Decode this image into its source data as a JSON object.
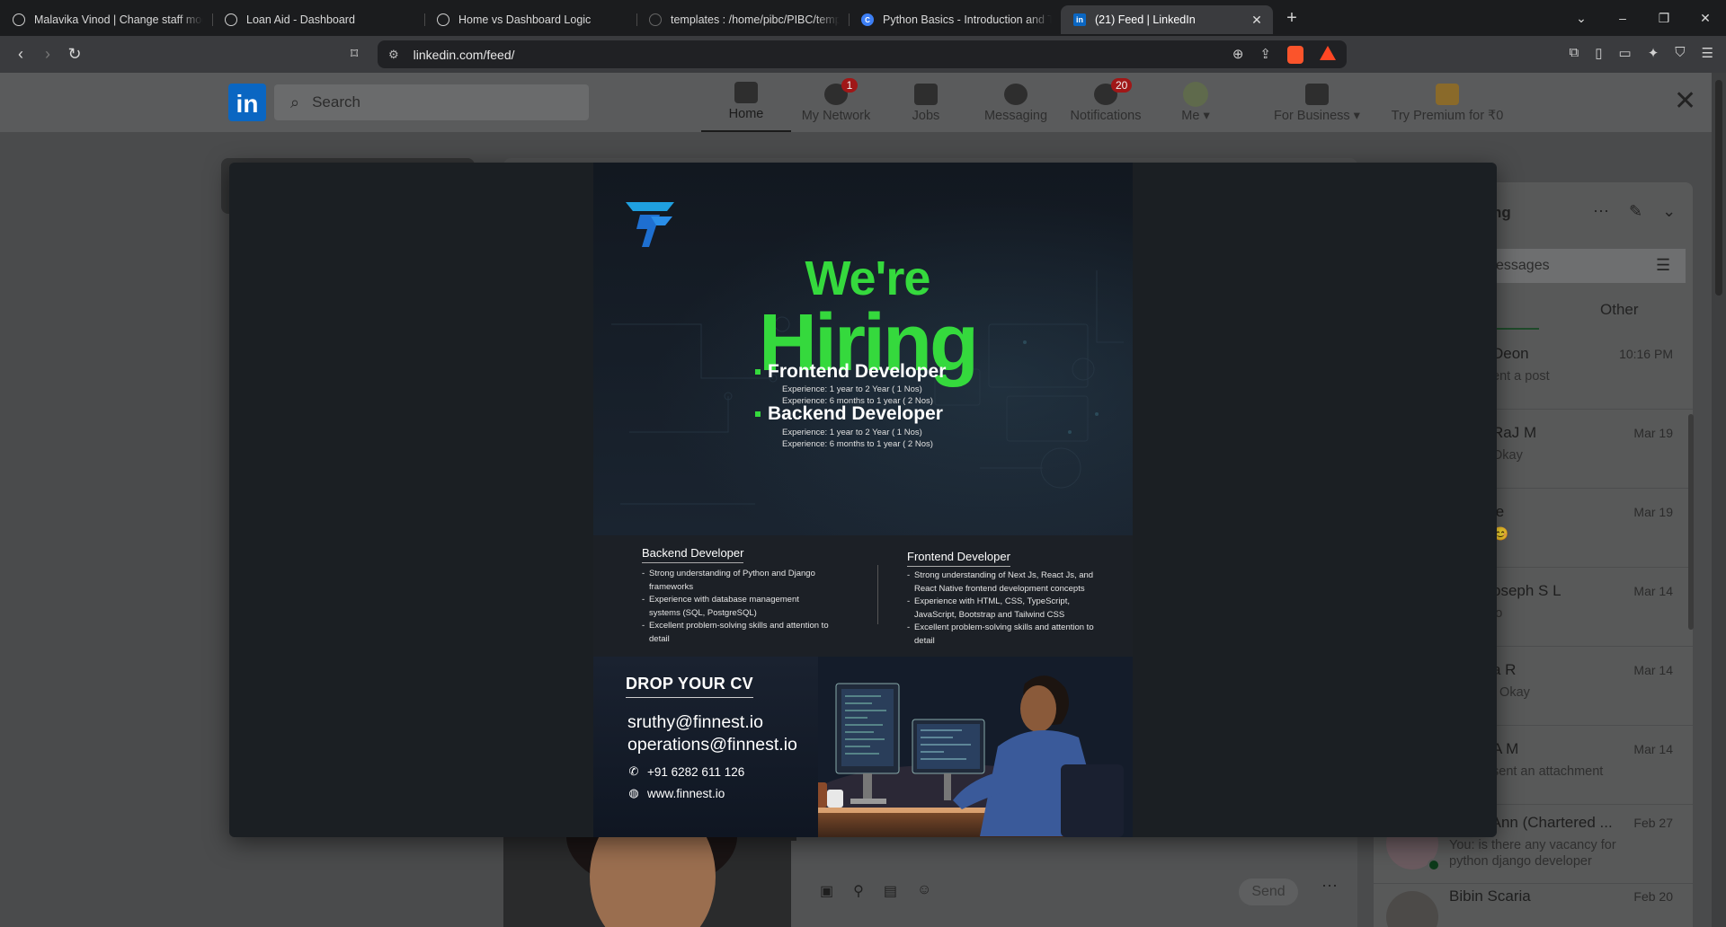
{
  "browser": {
    "tabs": [
      {
        "title": "Malavika Vinod | Change staff mode",
        "icon": "globe-icon",
        "active": false
      },
      {
        "title": "Loan Aid - Dashboard",
        "icon": "globe-icon",
        "active": false
      },
      {
        "title": "Home vs Dashboard Logic",
        "icon": "openai-icon",
        "active": false
      },
      {
        "title": "templates : /home/pibc/PIBC/templ",
        "icon": "github-icon",
        "active": false
      },
      {
        "title": "Python Basics - Introduction and Th",
        "icon": "c-icon",
        "active": false
      },
      {
        "title": "(21) Feed | LinkedIn",
        "icon": "linkedin-icon",
        "active": true
      }
    ],
    "url": "linkedin.com/feed/"
  },
  "linkedin": {
    "logo_text": "in",
    "search_placeholder": "Search",
    "nav": [
      {
        "label": "Home",
        "icon": "home-icon",
        "badge": "",
        "active": true
      },
      {
        "label": "My Network",
        "icon": "network-icon",
        "badge": "1",
        "active": false
      },
      {
        "label": "Jobs",
        "icon": "briefcase-icon",
        "badge": "",
        "active": false
      },
      {
        "label": "Messaging",
        "icon": "chat-icon",
        "badge": "",
        "active": false
      },
      {
        "label": "Notifications",
        "icon": "bell-icon",
        "badge": "20",
        "active": false
      },
      {
        "label": "Me",
        "icon": "avatar",
        "badge": "",
        "active": false
      }
    ],
    "for_business": "For Business",
    "premium": "Try Premium for ₹0",
    "messaging": {
      "title": "ng",
      "search_placeholder": "essages",
      "tab_other": "Other",
      "conversations": [
        {
          "name": "Deon",
          "preview": "ent a post",
          "date": "10:16 PM"
        },
        {
          "name": "RaJ M",
          "preview": "Okay",
          "date": "Mar 19"
        },
        {
          "name": "le",
          "preview": "😊",
          "date": "Mar 19"
        },
        {
          "name": "oseph S L",
          "preview": "lo",
          "date": "Mar 14"
        },
        {
          "name": "a R",
          "preview": ": Okay",
          "date": "Mar 14"
        },
        {
          "name": "A M",
          "preview": "sent an attachment",
          "date": "Mar 14"
        },
        {
          "name": "Tresa Ann (Chartered ...",
          "preview": "You: is there any vacancy for python django developer",
          "date": "Feb 27"
        },
        {
          "name": "Bibin Scaria",
          "preview": "",
          "date": "Feb 20"
        }
      ]
    },
    "composer": {
      "send_label": "Send"
    }
  },
  "poster": {
    "headline_1": "We're",
    "headline_2": "Hiring",
    "roles": [
      {
        "title": "Frontend Developer",
        "exp": [
          "Experience: 1 year to 2 Year ( 1 Nos)",
          "Experience: 6 months to 1 year ( 2 Nos)"
        ]
      },
      {
        "title": "Backend Developer",
        "exp": [
          "Experience: 1 year to 2 Year ( 1 Nos)",
          "Experience: 6 months to 1 year ( 2 Nos)"
        ]
      }
    ],
    "backend_req": {
      "title": "Backend Developer",
      "items": [
        "Strong understanding of Python and Django frameworks",
        "Experience with database management systems (SQL, PostgreSQL)",
        "Excellent problem-solving skills and attention to detail"
      ]
    },
    "frontend_req": {
      "title": "Frontend Developer",
      "items": [
        "Strong understanding of Next Js, React Js, and React Native frontend development concepts",
        "Experience with HTML, CSS, TypeScript, JavaScript, Bootstrap and Tailwind CSS",
        "Excellent problem-solving skills and attention to detail"
      ]
    },
    "cta": "DROP YOUR CV",
    "emails": [
      "sruthy@finnest.io",
      "operations@finnest.io"
    ],
    "phone": "+91 6282 611 126",
    "website": "www.finnest.io",
    "brand_green": "#35d93d"
  }
}
